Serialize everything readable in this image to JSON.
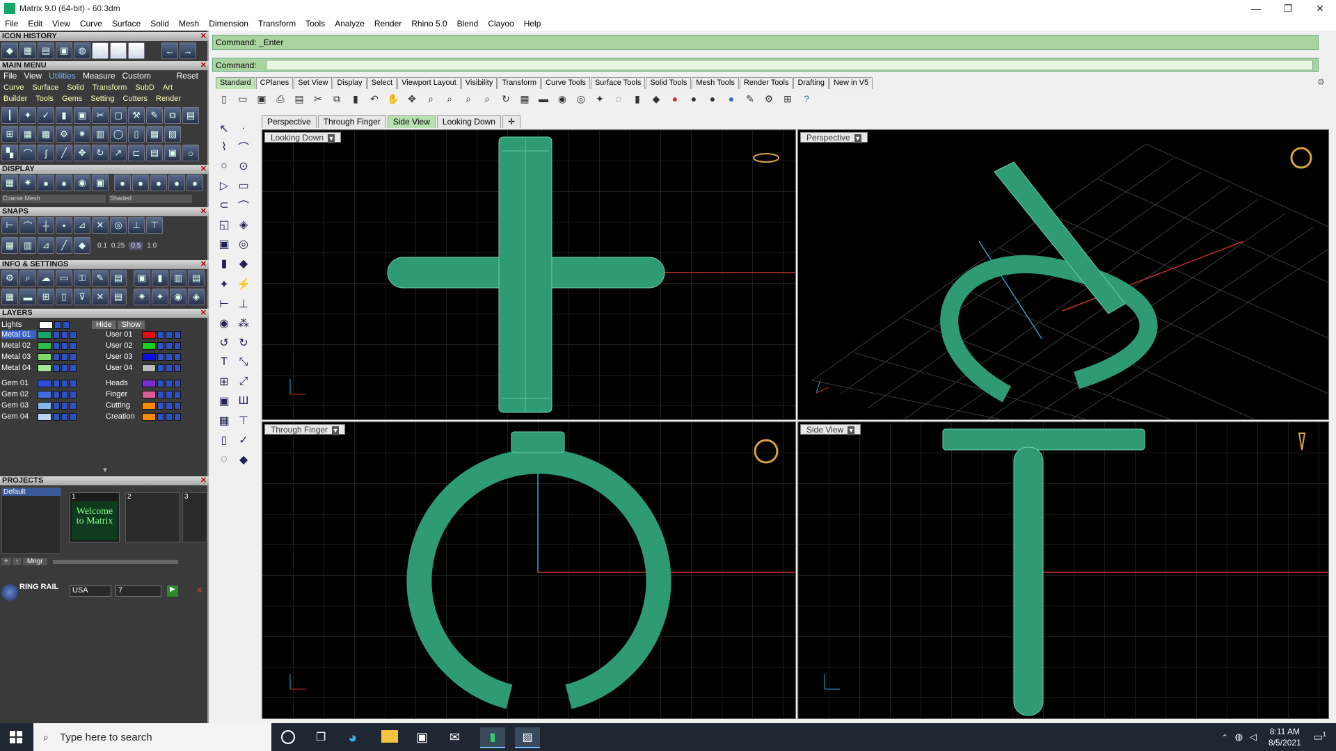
{
  "window": {
    "title": "Matrix 9.0 (64-bit) - 60.3dm"
  },
  "menu": [
    "File",
    "Edit",
    "View",
    "Curve",
    "Surface",
    "Solid",
    "Mesh",
    "Dimension",
    "Transform",
    "Tools",
    "Analyze",
    "Render",
    "Rhino 5.0",
    "Blend",
    "Clayoo",
    "Help"
  ],
  "left_panel": {
    "icon_history": "ICON HISTORY",
    "main_menu": "MAIN MENU",
    "main_menu_items": [
      "File",
      "View",
      "Utilities",
      "Measure",
      "Custom",
      "Reset"
    ],
    "tags_row1": [
      "Curve",
      "Surface",
      "Solid",
      "Transform",
      "SubD",
      "Art"
    ],
    "tags_row2": [
      "Builder",
      "Tools",
      "Gems",
      "Setting",
      "Cutters",
      "Render"
    ],
    "display": "DISPLAY",
    "display_selects": [
      "Coarse Mesh",
      "Shaded"
    ],
    "snaps": "SNAPS",
    "snap_values": [
      "0.1",
      "0.25",
      "0.5",
      "1.0"
    ],
    "info_settings": "INFO & SETTINGS",
    "layers": "LAYERS",
    "layer_lights": "Lights",
    "layer_hide": "Hide",
    "layer_show": "Show",
    "layers_left": [
      {
        "name": "Metal 01",
        "color": "#1aa36a"
      },
      {
        "name": "Metal 02",
        "color": "#2fbf4a"
      },
      {
        "name": "Metal 03",
        "color": "#7fd96a"
      },
      {
        "name": "Metal 04",
        "color": "#a7e89a"
      },
      {
        "name": "Gem 01",
        "color": "#2a4fd8"
      },
      {
        "name": "Gem 02",
        "color": "#3d6fe0"
      },
      {
        "name": "Gem 03",
        "color": "#86b6f0"
      },
      {
        "name": "Gem 04",
        "color": "#b9d4f5"
      }
    ],
    "layers_right": [
      {
        "name": "User 01",
        "color": "#e01010"
      },
      {
        "name": "User 02",
        "color": "#19d019"
      },
      {
        "name": "User 03",
        "color": "#1010e0"
      },
      {
        "name": "User 04",
        "color": "#bbbbbb"
      },
      {
        "name": "Heads",
        "color": "#7a2ad0"
      },
      {
        "name": "Finger",
        "color": "#e05a95"
      },
      {
        "name": "Cutting",
        "color": "#ff8a00"
      },
      {
        "name": "Creation",
        "color": "#ff8a00"
      }
    ],
    "projects": "PROJECTS",
    "project_default": "Default",
    "project_slots": [
      "1",
      "2",
      "3"
    ],
    "project_thumb_text": "Welcome to Matrix",
    "mngr": "Mngr",
    "ring_rail": "RING RAIL",
    "ring_standard": "USA",
    "ring_size": "7"
  },
  "command": {
    "history": "Command: _Enter",
    "prompt": "Command:"
  },
  "toolbar_tabs": [
    "Standard",
    "CPlanes",
    "Set View",
    "Display",
    "Select",
    "Viewport Layout",
    "Visibility",
    "Transform",
    "Curve Tools",
    "Surface Tools",
    "Solid Tools",
    "Mesh Tools",
    "Render Tools",
    "Drafting",
    "New in V5"
  ],
  "view_tabs": [
    "Perspective",
    "Through Finger",
    "Side View",
    "Looking Down"
  ],
  "viewports": {
    "top_left": "Looking Down",
    "top_right": "Perspective",
    "bottom_left": "Through Finger",
    "bottom_right": "Side View"
  },
  "taskbar": {
    "search_placeholder": "Type here to search",
    "time": "8:11 AM",
    "date": "8/5/2021",
    "notif": "1"
  },
  "colors": {
    "model_green": "#2e9b74",
    "grid": "#3a3a3a",
    "x_axis": "#c0302c",
    "y_axis": "#27a9c9"
  }
}
